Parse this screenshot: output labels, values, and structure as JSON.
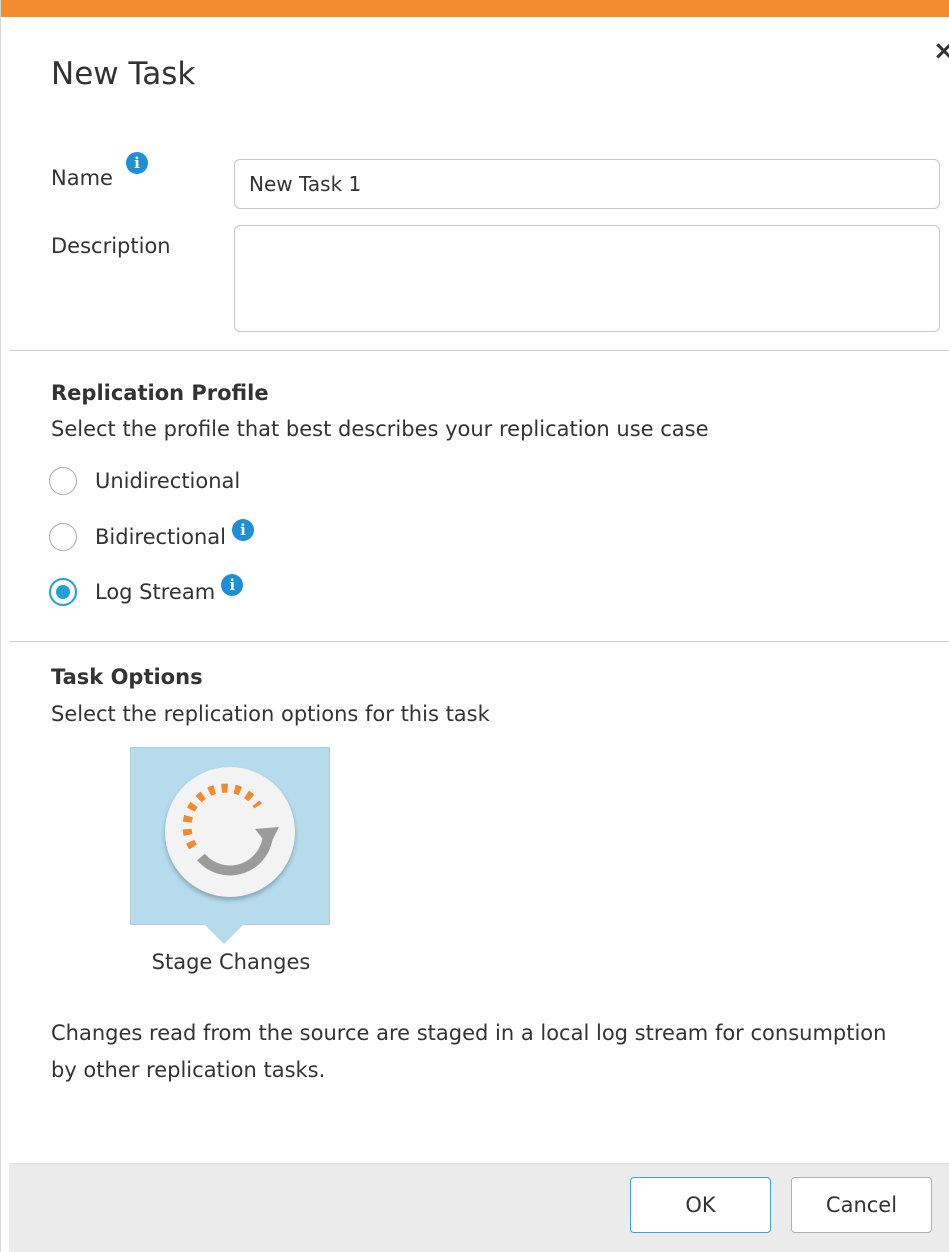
{
  "dialog": {
    "title": "New Task",
    "close_glyph": "×",
    "accent_color": "#f28a2e",
    "info_color": "#1e8fd4",
    "radio_color": "#1fa0d8"
  },
  "form": {
    "name_label": "Name",
    "name_value": "New Task 1",
    "description_label": "Description",
    "description_value": ""
  },
  "replication_profile": {
    "title": "Replication Profile",
    "subtitle": "Select the profile that best describes your replication use case",
    "options": [
      {
        "label": "Unidirectional",
        "selected": false,
        "info_icon": false
      },
      {
        "label": "Bidirectional",
        "selected": false,
        "info_icon": true
      },
      {
        "label": "Log Stream",
        "selected": true,
        "info_icon": true
      }
    ]
  },
  "task_options": {
    "title": "Task Options",
    "subtitle": "Select the replication options for this task",
    "tile_label": "Stage Changes",
    "tile_icon": "stage-changes-icon",
    "description": "Changes read from the source are staged in a local log stream for consumption by other replication tasks."
  },
  "footer": {
    "ok_label": "OK",
    "cancel_label": "Cancel"
  }
}
